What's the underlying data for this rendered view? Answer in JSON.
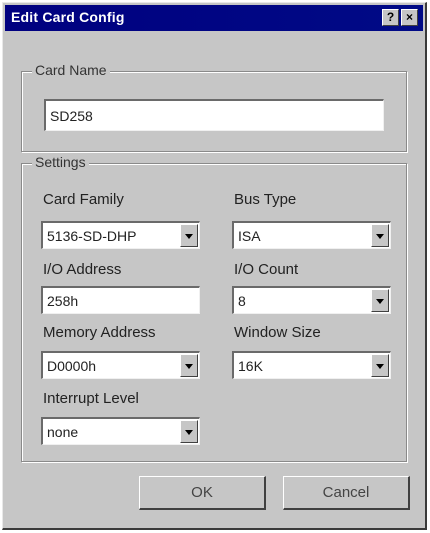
{
  "window": {
    "title": "Edit Card Config",
    "help_label": "?",
    "close_label": "×"
  },
  "card_name_group": {
    "legend": "Card Name",
    "value": "SD258"
  },
  "settings_group": {
    "legend": "Settings",
    "card_family": {
      "label": "Card Family",
      "value": "5136-SD-DHP"
    },
    "bus_type": {
      "label": "Bus Type",
      "value": "ISA"
    },
    "io_address": {
      "label": "I/O Address",
      "value": "258h"
    },
    "io_count": {
      "label": "I/O Count",
      "value": "8"
    },
    "memory_address": {
      "label": "Memory Address",
      "value": "D0000h"
    },
    "window_size": {
      "label": "Window Size",
      "value": "16K"
    },
    "interrupt_level": {
      "label": "Interrupt Level",
      "value": "none"
    }
  },
  "buttons": {
    "ok": "OK",
    "cancel": "Cancel"
  }
}
